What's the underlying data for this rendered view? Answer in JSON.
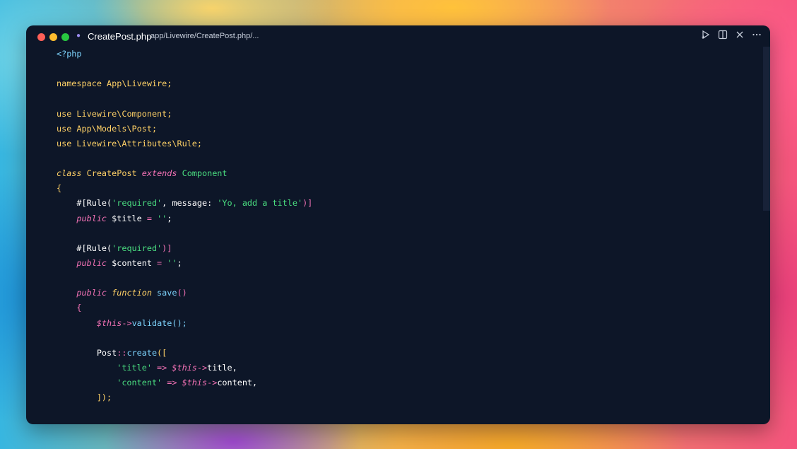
{
  "window": {
    "file_name": "CreatePost.php",
    "file_path": "app/Livewire/CreatePost.php/...",
    "icons": {
      "file": "php-icon",
      "run": "run-icon",
      "split": "split-editor-icon",
      "close": "close-icon",
      "more": "more-icon"
    }
  },
  "code": {
    "line1": "<?php",
    "line2": "",
    "line3": {
      "a": "namespace",
      "b": "App\\Livewire;"
    },
    "line4": "",
    "line5": {
      "a": "use",
      "b": "Livewire\\Component;"
    },
    "line6": {
      "a": "use",
      "b": "App\\Models\\Post;"
    },
    "line7": {
      "a": "use",
      "b": "Livewire\\Attributes\\Rule;"
    },
    "line8": "",
    "line9": {
      "a": "class",
      "b": "CreatePost",
      "c": "extends",
      "d": "Component"
    },
    "line10": "{",
    "line11": {
      "a": "    #[Rule(",
      "b": "'required'",
      "c": ", message: ",
      "d": "'Yo, add a title'",
      "e": ")]"
    },
    "line12": {
      "a": "    public",
      "b": " $title",
      "c": " = ",
      "d": "''",
      "e": ";"
    },
    "line13": "",
    "line14": {
      "a": "    #[Rule(",
      "b": "'required'",
      "c": ")]"
    },
    "line15": {
      "a": "    public",
      "b": " $content",
      "c": " = ",
      "d": "''",
      "e": ";"
    },
    "line16": "",
    "line17": {
      "a": "    public",
      "b": " function",
      "c": " save",
      "d": "()"
    },
    "line18": "    {",
    "line19": {
      "a": "        $this",
      "b": "->",
      "c": "validate",
      "d": "();"
    },
    "line20": "",
    "line21": {
      "a": "        Post",
      "b": "::",
      "c": "create",
      "d": "(["
    },
    "line22": {
      "a": "            'title'",
      "b": " => ",
      "c": "$this",
      "d": "->",
      "e": "title",
      "f": ","
    },
    "line23": {
      "a": "            'content'",
      "b": " => ",
      "c": "$this",
      "d": "->",
      "e": "content",
      "f": ","
    },
    "line24": "        ]);"
  }
}
